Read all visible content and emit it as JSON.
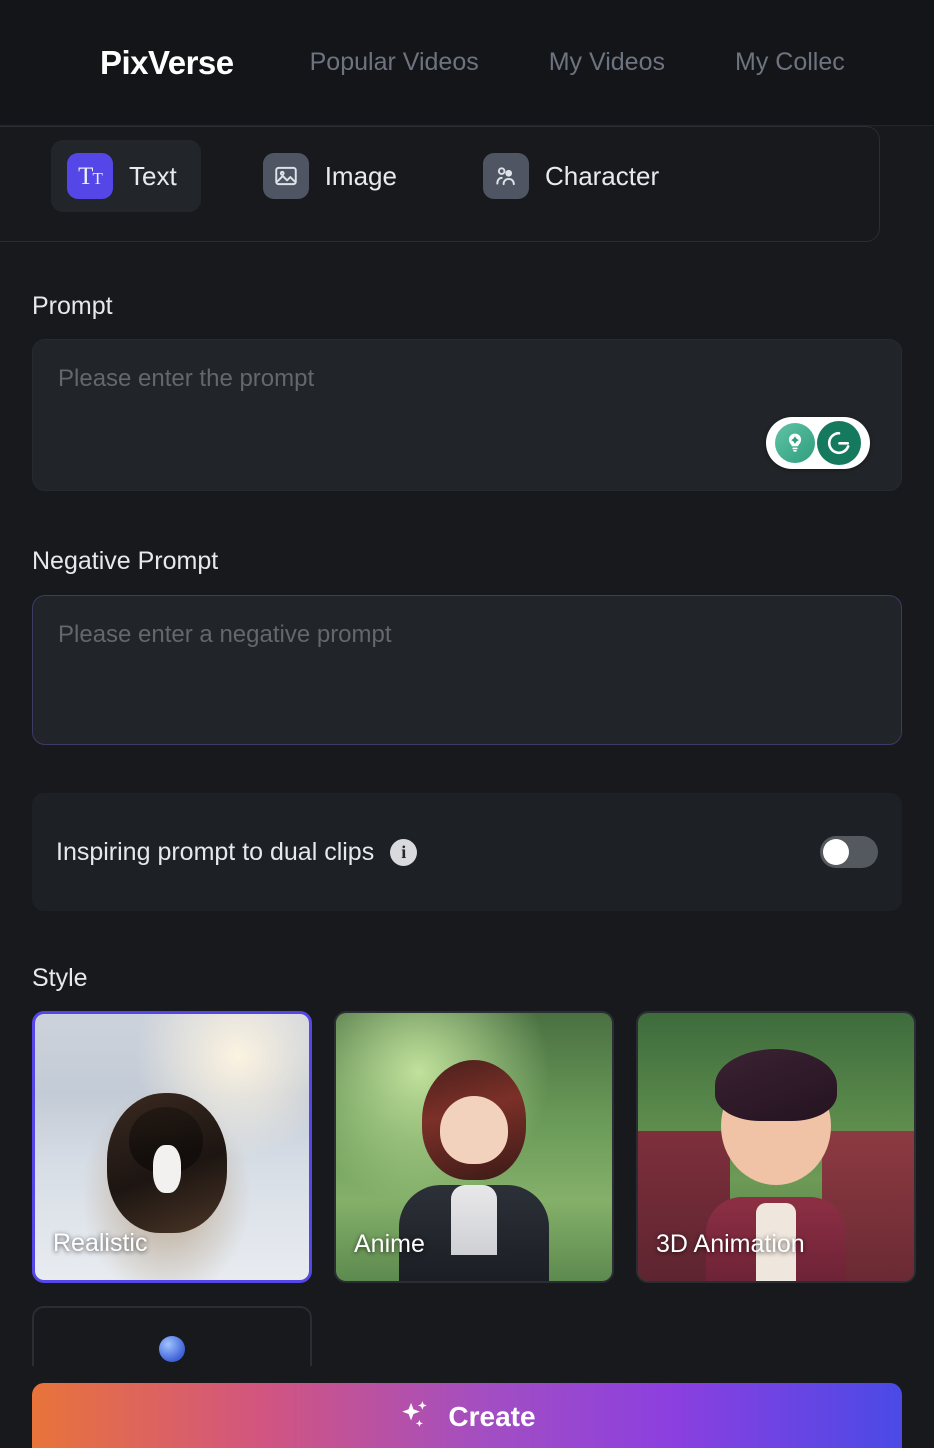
{
  "navbar": {
    "brand": "PixVerse",
    "links": [
      {
        "label": "Popular Videos",
        "name": "popular-videos"
      },
      {
        "label": "My Videos",
        "name": "my-videos"
      },
      {
        "label": "My Collec",
        "name": "my-collection"
      }
    ]
  },
  "mode_selector": {
    "items": [
      {
        "label": "Text",
        "icon": "text-tt-icon",
        "selected": true
      },
      {
        "label": "Image",
        "icon": "image-icon",
        "selected": false
      },
      {
        "label": "Character",
        "icon": "character-icon",
        "selected": false
      }
    ]
  },
  "prompt": {
    "label": "Prompt",
    "placeholder": "Please enter the prompt",
    "value": "",
    "grammarly": {
      "bulb_icon": "lightbulb-idea-icon",
      "logo_icon": "grammarly-g-icon"
    }
  },
  "negative_prompt": {
    "label": "Negative Prompt",
    "placeholder": "Please enter a negative prompt",
    "value": ""
  },
  "dual_clips": {
    "label": "Inspiring prompt to dual clips",
    "info_icon": "info-icon",
    "info_glyph": "i",
    "enabled": false
  },
  "style": {
    "label": "Style",
    "cards": [
      {
        "label": "Realistic",
        "selected": true,
        "art": "art-realistic"
      },
      {
        "label": "Anime",
        "selected": false,
        "art": "art-anime"
      },
      {
        "label": "3D Animation",
        "selected": false,
        "art": "art-3d"
      },
      {
        "label": "",
        "selected": false,
        "art": "art-fantasy"
      }
    ]
  },
  "create_button": {
    "label": "Create",
    "icon": "sparkle-icon"
  },
  "colors": {
    "accent_purple": "#5546e8",
    "page_background": "#17191d",
    "navbar_background": "#131518",
    "field_background": "#212428",
    "grammarly_green": "#15795e"
  }
}
